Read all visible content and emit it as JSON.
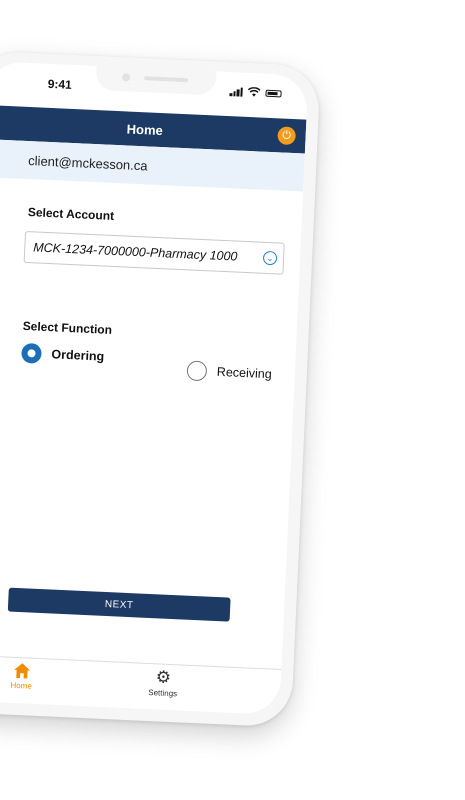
{
  "status": {
    "time": "9:41"
  },
  "header": {
    "title": "Home"
  },
  "account_email": "client@mckesson.ca",
  "select_account": {
    "label": "Select Account",
    "value": "MCK-1234-7000000-Pharmacy 1000"
  },
  "select_function": {
    "label": "Select Function",
    "options": [
      {
        "label": "Ordering",
        "selected": true
      },
      {
        "label": "Receiving",
        "selected": false
      }
    ]
  },
  "next_button": "NEXT",
  "tabs": [
    {
      "label": "Home",
      "icon": "home-icon",
      "active": true
    },
    {
      "label": "Settings",
      "icon": "gear-icon",
      "active": false
    }
  ],
  "colors": {
    "header": "#1c3a63",
    "accent_orange": "#f39c1e",
    "email_bar": "#e9f2fb",
    "radio_selected": "#1a6fb6"
  }
}
